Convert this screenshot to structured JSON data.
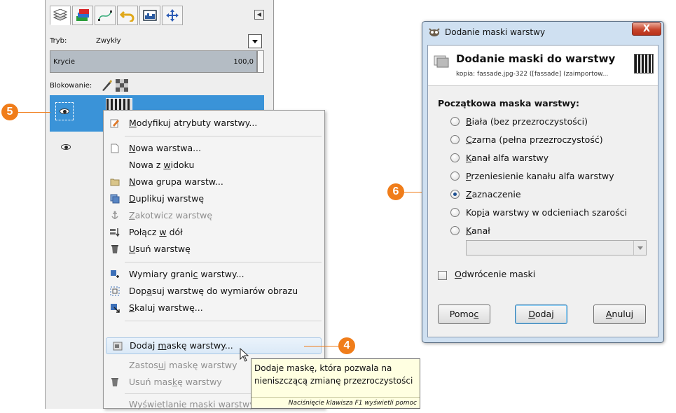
{
  "layers_panel": {
    "mode_label": "Tryb:",
    "mode_value": "Zwykły",
    "opacity_label": "Krycie",
    "opacity_value": "100,0",
    "lock_label": "Blokowanie:"
  },
  "context_menu": {
    "items": [
      {
        "pre": "",
        "u": "M",
        "post": "odyfikuj atrybuty warstwy...",
        "icon": "edit-attributes-icon",
        "disabled": false
      },
      {
        "pre": "",
        "u": "N",
        "post": "owa warstwa...",
        "icon": "new-layer-icon",
        "disabled": false
      },
      {
        "pre": "Nowa z ",
        "u": "w",
        "post": "idoku",
        "icon": "",
        "disabled": false
      },
      {
        "pre": "",
        "u": "N",
        "post": "owa grupa warstw...",
        "icon": "folder-icon",
        "disabled": false
      },
      {
        "pre": "",
        "u": "D",
        "post": "uplikuj warstwę",
        "icon": "duplicate-icon",
        "disabled": false
      },
      {
        "pre": "",
        "u": "Z",
        "post": "akotwicz warstwę",
        "icon": "anchor-icon",
        "disabled": true
      },
      {
        "pre": "Połącz ",
        "u": "w",
        "post": " dół",
        "icon": "merge-down-icon",
        "disabled": false
      },
      {
        "pre": "",
        "u": "U",
        "post": "suń warstwę",
        "icon": "delete-icon",
        "disabled": false
      },
      {
        "pre": "Wymiary grani",
        "u": "c",
        "post": " warstwy...",
        "icon": "layer-boundary-icon",
        "disabled": false
      },
      {
        "pre": "Dop",
        "u": "a",
        "post": "suj warstwę do wymiarów obrazu",
        "icon": "fit-layer-icon",
        "disabled": false
      },
      {
        "pre": "",
        "u": "S",
        "post": "kaluj warstwę...",
        "icon": "scale-layer-icon",
        "disabled": false
      },
      {
        "pre": "Dodaj ",
        "u": "m",
        "post": "askę warstwy...",
        "icon": "add-mask-icon",
        "disabled": false
      },
      {
        "pre": "Zastos",
        "u": "u",
        "post": "j maskę warstwy",
        "icon": "",
        "disabled": true
      },
      {
        "pre": "Usuń mas",
        "u": "k",
        "post": "ę warstwy",
        "icon": "delete-icon",
        "disabled": true
      },
      {
        "pre": "Wyświetlanie maski warstwy",
        "u": "",
        "post": "",
        "icon": "",
        "disabled": true
      }
    ]
  },
  "tooltip": {
    "text": "Dodaje maskę, która pozwala na nieniszczącą zmianę przezroczystości",
    "hint": "Naciśnięcie klawisza F1 wyświetli pomoc"
  },
  "callouts": {
    "c4": "4",
    "c5": "5",
    "c6": "6"
  },
  "dialog": {
    "window_title": "Dodanie maski warstwy",
    "close_glyph": "X",
    "header_title": "Dodanie maski do warstwy",
    "header_subtitle": "kopia: fassade.jpg-322 ([fassade] (zaimportow...",
    "section_label": "Początkowa maska warstwy:",
    "options": [
      {
        "pre": "",
        "u": "B",
        "post": "iała (bez przezroczystości)",
        "checked": false
      },
      {
        "pre": "",
        "u": "C",
        "post": "zarna (pełna przezroczystość)",
        "checked": false
      },
      {
        "pre": "",
        "u": "K",
        "post": "anał alfa warstwy",
        "checked": false
      },
      {
        "pre": "",
        "u": "P",
        "post": "rzeniesienie kanału alfa warstwy",
        "checked": false
      },
      {
        "pre": "",
        "u": "Z",
        "post": "aznaczenie",
        "checked": true
      },
      {
        "pre": "Kop",
        "u": "i",
        "post": "a warstwy w odcieniach szarości",
        "checked": false
      },
      {
        "pre": "",
        "u": "K",
        "post": "anał",
        "checked": false
      }
    ],
    "invert": {
      "pre": "",
      "u": "O",
      "post": "dwrócenie maski"
    },
    "buttons": {
      "help": {
        "pre": "Pomo",
        "u": "c",
        "post": ""
      },
      "add": {
        "pre": "",
        "u": "D",
        "post": "odaj"
      },
      "cancel": {
        "pre": "",
        "u": "A",
        "post": "nuluj"
      }
    }
  },
  "colors": {
    "accent_orange": "#f07d1a",
    "selection_blue": "#3a93d8",
    "close_red": "#c7452c"
  }
}
